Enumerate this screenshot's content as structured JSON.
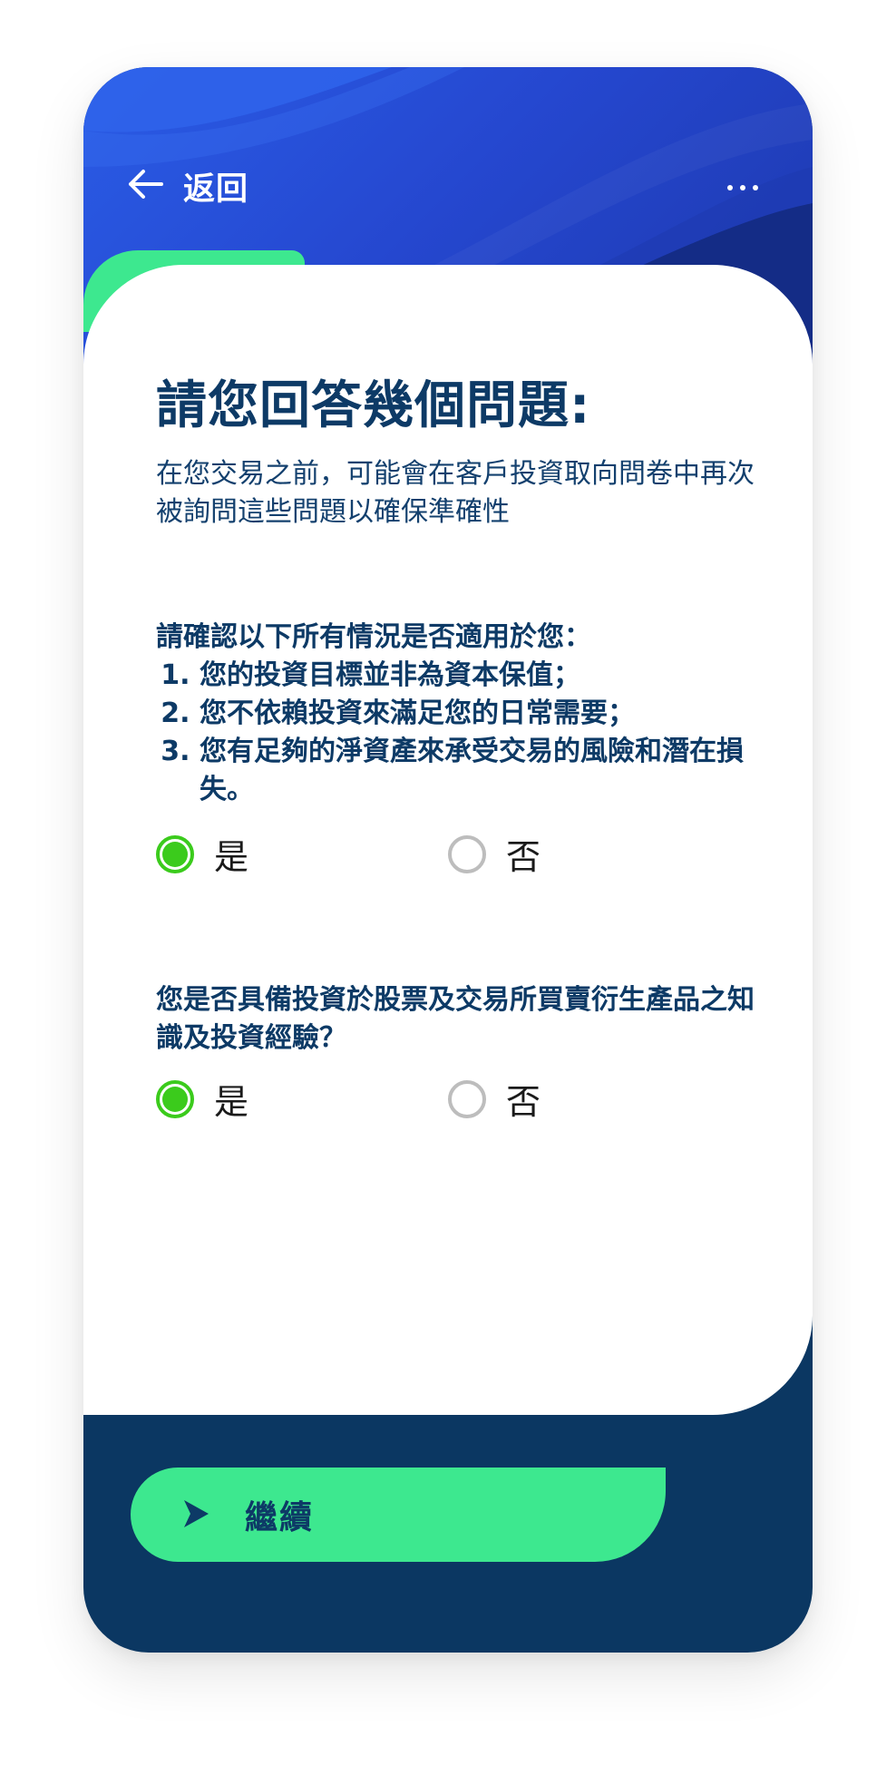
{
  "header": {
    "back_label": "返回",
    "back_icon": "arrow-left-icon",
    "more_icon": "more-horizontal-icon"
  },
  "content": {
    "title": "請您回答幾個問題:",
    "subtitle": "在您交易之前，可能會在客戶投資取向問卷中再次被詢問這些問題以確保準確性"
  },
  "question1": {
    "intro": "請確認以下所有情況是否適用於您：",
    "items": [
      "您的投資目標並非為資本保值；",
      "您不依賴投資來滿足您的日常需要；",
      "您有足夠的淨資產來承受交易的風險和潛在損失。"
    ],
    "options": {
      "yes": "是",
      "no": "否"
    },
    "selected": "yes"
  },
  "question2": {
    "text": "您是否具備投資於股票及交易所買賣衍生產品之知識及投資經驗？",
    "options": {
      "yes": "是",
      "no": "否"
    },
    "selected": "yes"
  },
  "footer": {
    "continue_label": "繼續",
    "continue_icon": "play-icon"
  },
  "colors": {
    "navy": "#0b3762",
    "blue": "#2547cf",
    "accent_green": "#3de88f",
    "radio_green": "#3bcb1c"
  }
}
